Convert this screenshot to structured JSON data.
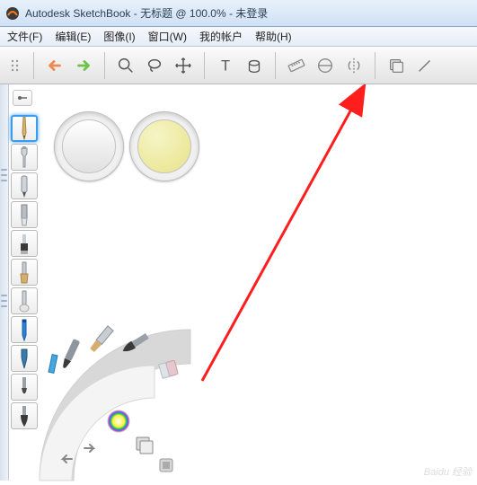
{
  "window": {
    "title": "Autodesk SketchBook - 无标题 @ 100.0% - 未登录"
  },
  "menu": {
    "file": "文件(F)",
    "edit": "编辑(E)",
    "image": "图像(I)",
    "window": "窗口(W)",
    "account": "我的帐户",
    "help": "帮助(H)"
  },
  "toolbar_icons": {
    "undo": "undo",
    "redo": "redo",
    "zoom": "zoom",
    "lasso": "lasso",
    "move": "move",
    "text": "text",
    "bucket": "bucket",
    "ruler": "ruler",
    "ellipse_guide": "ellipse-guide",
    "symmetry": "symmetry",
    "layers": "layers",
    "pen": "pen"
  },
  "brushes": [
    {
      "name": "pencil",
      "selected": true
    },
    {
      "name": "airbrush",
      "selected": false
    },
    {
      "name": "marker",
      "selected": false
    },
    {
      "name": "chisel",
      "selected": false
    },
    {
      "name": "flat-brush",
      "selected": false
    },
    {
      "name": "paint",
      "selected": false
    },
    {
      "name": "smudge",
      "selected": false
    },
    {
      "name": "ballpoint",
      "selected": false
    },
    {
      "name": "ink",
      "selected": false
    },
    {
      "name": "brush-hard",
      "selected": false
    },
    {
      "name": "brush-soft",
      "selected": false
    }
  ],
  "pucks": {
    "left": "brush-size",
    "right": "color"
  },
  "colors": {
    "accent": "#3a9bf0",
    "arrow_annotation": "#ff1e1e"
  },
  "watermark": "Baidu 经验"
}
